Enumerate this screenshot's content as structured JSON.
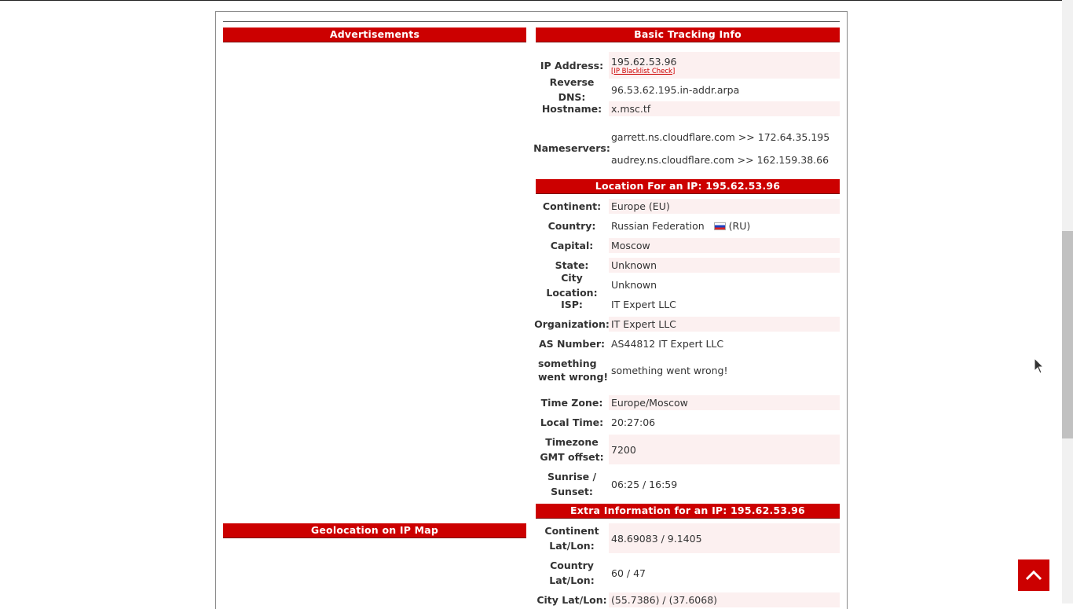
{
  "sections": {
    "advertisements": "Advertisements",
    "basic_tracking": "Basic Tracking Info",
    "location": "Location For an IP: 195.62.53.96",
    "geolocation": "Geolocation on IP Map",
    "extra": "Extra Information for an IP: 195.62.53.96"
  },
  "basic": {
    "ip_label": "IP Address:",
    "ip_value": "195.62.53.96",
    "blacklist_link": "[IP Blacklist Check]",
    "rdns_label": "Reverse DNS:",
    "rdns_value": "96.53.62.195.in-addr.arpa",
    "hostname_label": "Hostname:",
    "hostname_value": "x.msc.tf",
    "ns_label": "Nameservers:",
    "ns1": "garrett.ns.cloudflare.com >> 172.64.35.195",
    "ns2": "audrey.ns.cloudflare.com >> 162.159.38.66"
  },
  "location": {
    "continent_label": "Continent:",
    "continent_value": "Europe (EU)",
    "country_label": "Country:",
    "country_value": "Russian Federation",
    "country_code": "(RU)",
    "capital_label": "Capital:",
    "capital_value": "Moscow",
    "state_label": "State:",
    "state_value": "Unknown",
    "city_label": "City Location:",
    "city_value": "Unknown",
    "isp_label": "ISP:",
    "isp_value": "IT Expert LLC",
    "org_label": "Organization:",
    "org_value": "IT Expert LLC",
    "as_label": "AS Number:",
    "as_value": "AS44812 IT Expert LLC",
    "err_label": "something went wrong!",
    "err_value": "something went wrong!",
    "tz_label": "Time Zone:",
    "tz_value": "Europe/Moscow",
    "lt_label": "Local Time:",
    "lt_value": "20:27:06",
    "gmt_label": "Timezone GMT offset:",
    "gmt_value": "7200",
    "sun_label": "Sunrise / Sunset:",
    "sun_value": "06:25 / 16:59"
  },
  "extra": {
    "cont_ll_label": "Continent Lat/Lon:",
    "cont_ll_value": "48.69083 / 9.1405",
    "country_ll_label": "Country Lat/Lon:",
    "country_ll_value": "60 / 47",
    "city_ll_label": "City Lat/Lon:",
    "city_ll_value": "(55.7386) / (37.6068)"
  },
  "colors": {
    "accent": "#cc0000",
    "row_shade": "#fcf0f0"
  },
  "icons": {
    "flag": "russia-flag-icon",
    "scroll_top": "chevron-up-icon",
    "cursor": "mouse-pointer-icon"
  }
}
